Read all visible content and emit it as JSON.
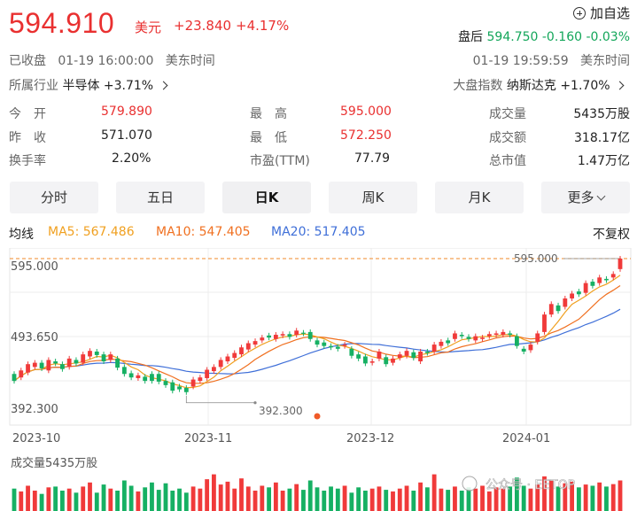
{
  "quote": {
    "price": "594.910",
    "currency": "美元",
    "change": "+23.840",
    "change_pct": "+4.17%",
    "watchlist_label": "加自选",
    "status": "已收盘",
    "close_time": "01-19 16:00:00",
    "timezone": "美东时间",
    "after_hours_label": "盘后",
    "after_hours_price": "594.750",
    "after_hours_change": "-0.160",
    "after_hours_pct": "-0.03%",
    "after_hours_time": "01-19 19:59:59",
    "industry_label": "所属行业",
    "industry_name": "半导体",
    "industry_change": "+3.71%",
    "index_label": "大盘指数",
    "index_name": "纳斯达克",
    "index_change": "+1.70%"
  },
  "stats": [
    {
      "label": "今　开",
      "value": "579.890"
    },
    {
      "label": "最　高",
      "value": "595.000"
    },
    {
      "label": "成交量",
      "value": "5435万股"
    },
    {
      "label": "昨　收",
      "value": "571.070"
    },
    {
      "label": "最　低",
      "value": "572.250"
    },
    {
      "label": "成交额",
      "value": "318.17亿"
    },
    {
      "label": "换手率",
      "value": "2.20%"
    },
    {
      "label": "市盈(TTM)",
      "value": "77.79"
    },
    {
      "label": "总市值",
      "value": "1.47万亿"
    }
  ],
  "tabs": [
    "分时",
    "五日",
    "日K",
    "周K",
    "月K",
    "更多"
  ],
  "active_tab": "日K",
  "indicators": {
    "label": "均线",
    "ma5": "MA5: 567.486",
    "ma10": "MA10: 547.405",
    "ma20": "MA20: 517.405",
    "adjust": "不复权"
  },
  "chart_data": {
    "type": "candlestick",
    "y_ticks": [
      "595.000",
      "493.650",
      "392.300"
    ],
    "x_ticks": [
      "2023-10",
      "2023-11",
      "2023-12",
      "2024-01"
    ],
    "ylim": [
      392.3,
      595.0
    ],
    "high_marker": "595.000",
    "low_marker": "392.300",
    "volume_label": "成交量5435万股",
    "candles": [
      {
        "o": 430,
        "c": 420
      },
      {
        "o": 425,
        "c": 435
      },
      {
        "o": 432,
        "c": 444
      },
      {
        "o": 440,
        "c": 446
      },
      {
        "o": 446,
        "c": 438
      },
      {
        "o": 435,
        "c": 450
      },
      {
        "o": 448,
        "c": 445
      },
      {
        "o": 444,
        "c": 437
      },
      {
        "o": 440,
        "c": 452
      },
      {
        "o": 450,
        "c": 445
      },
      {
        "o": 446,
        "c": 458
      },
      {
        "o": 455,
        "c": 463
      },
      {
        "o": 462,
        "c": 457
      },
      {
        "o": 458,
        "c": 448
      },
      {
        "o": 450,
        "c": 458
      },
      {
        "o": 452,
        "c": 439
      },
      {
        "o": 440,
        "c": 430
      },
      {
        "o": 431,
        "c": 425
      },
      {
        "o": 424,
        "c": 428
      },
      {
        "o": 426,
        "c": 420
      },
      {
        "o": 430,
        "c": 420
      },
      {
        "o": 430,
        "c": 419
      },
      {
        "o": 420,
        "c": 414
      },
      {
        "o": 418,
        "c": 406
      },
      {
        "o": 412,
        "c": 408
      },
      {
        "o": 410,
        "c": 404
      },
      {
        "o": 412,
        "c": 422
      },
      {
        "o": 420,
        "c": 425
      },
      {
        "o": 424,
        "c": 436
      },
      {
        "o": 434,
        "c": 440
      },
      {
        "o": 440,
        "c": 450
      },
      {
        "o": 448,
        "c": 455
      },
      {
        "o": 453,
        "c": 460
      },
      {
        "o": 458,
        "c": 468
      },
      {
        "o": 465,
        "c": 474
      },
      {
        "o": 472,
        "c": 477
      },
      {
        "o": 478,
        "c": 482
      },
      {
        "o": 485,
        "c": 482
      },
      {
        "o": 480,
        "c": 486
      },
      {
        "o": 485,
        "c": 487
      },
      {
        "o": 487,
        "c": 483
      },
      {
        "o": 486,
        "c": 492
      },
      {
        "o": 489,
        "c": 488
      },
      {
        "o": 490,
        "c": 480
      },
      {
        "o": 478,
        "c": 472
      },
      {
        "o": 475,
        "c": 470
      },
      {
        "o": 470,
        "c": 468
      },
      {
        "o": 469,
        "c": 466
      },
      {
        "o": 470,
        "c": 472
      },
      {
        "o": 466,
        "c": 456
      },
      {
        "o": 458,
        "c": 452
      },
      {
        "o": 455,
        "c": 445
      },
      {
        "o": 446,
        "c": 448
      },
      {
        "o": 452,
        "c": 462
      },
      {
        "o": 454,
        "c": 444
      },
      {
        "o": 446,
        "c": 452
      },
      {
        "o": 453,
        "c": 458
      },
      {
        "o": 456,
        "c": 463
      },
      {
        "o": 461,
        "c": 453
      },
      {
        "o": 448,
        "c": 462
      },
      {
        "o": 462,
        "c": 460
      },
      {
        "o": 462,
        "c": 472
      },
      {
        "o": 470,
        "c": 476
      },
      {
        "o": 478,
        "c": 474
      },
      {
        "o": 480,
        "c": 488
      },
      {
        "o": 486,
        "c": 484
      },
      {
        "o": 483,
        "c": 480
      },
      {
        "o": 478,
        "c": 484
      },
      {
        "o": 480,
        "c": 482
      },
      {
        "o": 484,
        "c": 487
      },
      {
        "o": 486,
        "c": 488
      },
      {
        "o": 486,
        "c": 490
      },
      {
        "o": 488,
        "c": 486
      },
      {
        "o": 484,
        "c": 470
      },
      {
        "o": 466,
        "c": 462
      },
      {
        "o": 464,
        "c": 472
      },
      {
        "o": 476,
        "c": 488
      },
      {
        "o": 490,
        "c": 515
      },
      {
        "o": 515,
        "c": 530
      },
      {
        "o": 528,
        "c": 520
      },
      {
        "o": 526,
        "c": 538
      },
      {
        "o": 538,
        "c": 545
      },
      {
        "o": 548,
        "c": 544
      },
      {
        "o": 546,
        "c": 560
      },
      {
        "o": 562,
        "c": 556
      },
      {
        "o": 560,
        "c": 568
      },
      {
        "o": 566,
        "c": 564
      },
      {
        "o": 568,
        "c": 573
      },
      {
        "o": 580,
        "c": 595
      }
    ],
    "volumes": [
      0.55,
      0.48,
      0.62,
      0.5,
      0.42,
      0.58,
      0.6,
      0.5,
      0.55,
      0.45,
      0.6,
      0.7,
      0.45,
      0.65,
      0.55,
      0.5,
      0.75,
      0.62,
      0.48,
      0.58,
      0.7,
      0.52,
      0.68,
      0.5,
      0.55,
      0.45,
      0.6,
      0.55,
      0.78,
      0.9,
      0.65,
      0.72,
      0.55,
      0.8,
      0.6,
      0.5,
      0.62,
      0.58,
      0.7,
      0.5,
      0.55,
      0.66,
      0.52,
      0.75,
      0.58,
      0.5,
      0.6,
      0.55,
      0.62,
      0.45,
      0.58,
      0.5,
      0.55,
      0.6,
      0.52,
      0.48,
      0.55,
      0.62,
      0.5,
      0.7,
      0.58,
      0.9,
      0.55,
      0.52,
      0.6,
      0.5,
      0.58,
      0.55,
      0.62,
      0.48,
      0.58,
      0.55,
      0.6,
      0.82,
      0.62,
      0.55,
      0.65,
      0.85,
      0.75,
      0.6,
      0.68,
      0.72,
      0.58,
      0.65,
      0.62,
      0.7,
      0.6,
      0.66,
      0.75
    ]
  },
  "watermark": "公众号 · EETOP"
}
